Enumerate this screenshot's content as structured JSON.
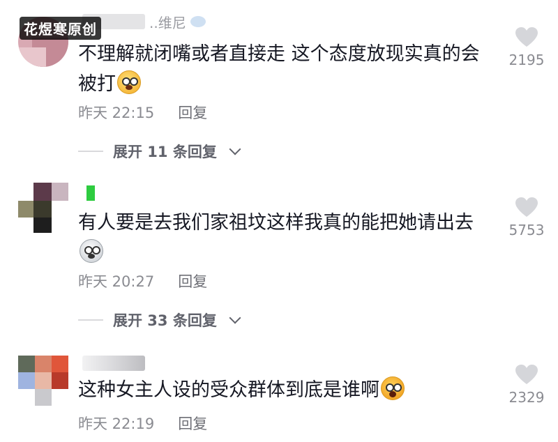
{
  "watermark": "花煜寒原创",
  "comments": [
    {
      "username_partial": "..维尼",
      "text": "不理解就闭嘴或者直接走 这个态度放现实真的会被打",
      "emoji": "shy-face-emoji",
      "time": "昨天 22:15",
      "reply_label": "回复",
      "expand_label": "展开 11 条回复",
      "likes": "2195"
    },
    {
      "username_partial": "",
      "text": "有人要是去我们家祖坟这样我真的能把她请出去",
      "emoji": "shocked-face-emoji",
      "time": "昨天 20:27",
      "reply_label": "回复",
      "expand_label": "展开 33 条回复",
      "likes": "5753"
    },
    {
      "username_partial": "",
      "text": "这种女主人设的受众群体到底是谁啊",
      "emoji": "screaming-face-emoji",
      "time": "昨天 22:19",
      "reply_label": "回复",
      "likes": "2329"
    }
  ],
  "colors": {
    "text": "#161823",
    "meta": "#8a8b91",
    "heart": "#d5d6da",
    "avatar_green": "#2ecc40"
  }
}
